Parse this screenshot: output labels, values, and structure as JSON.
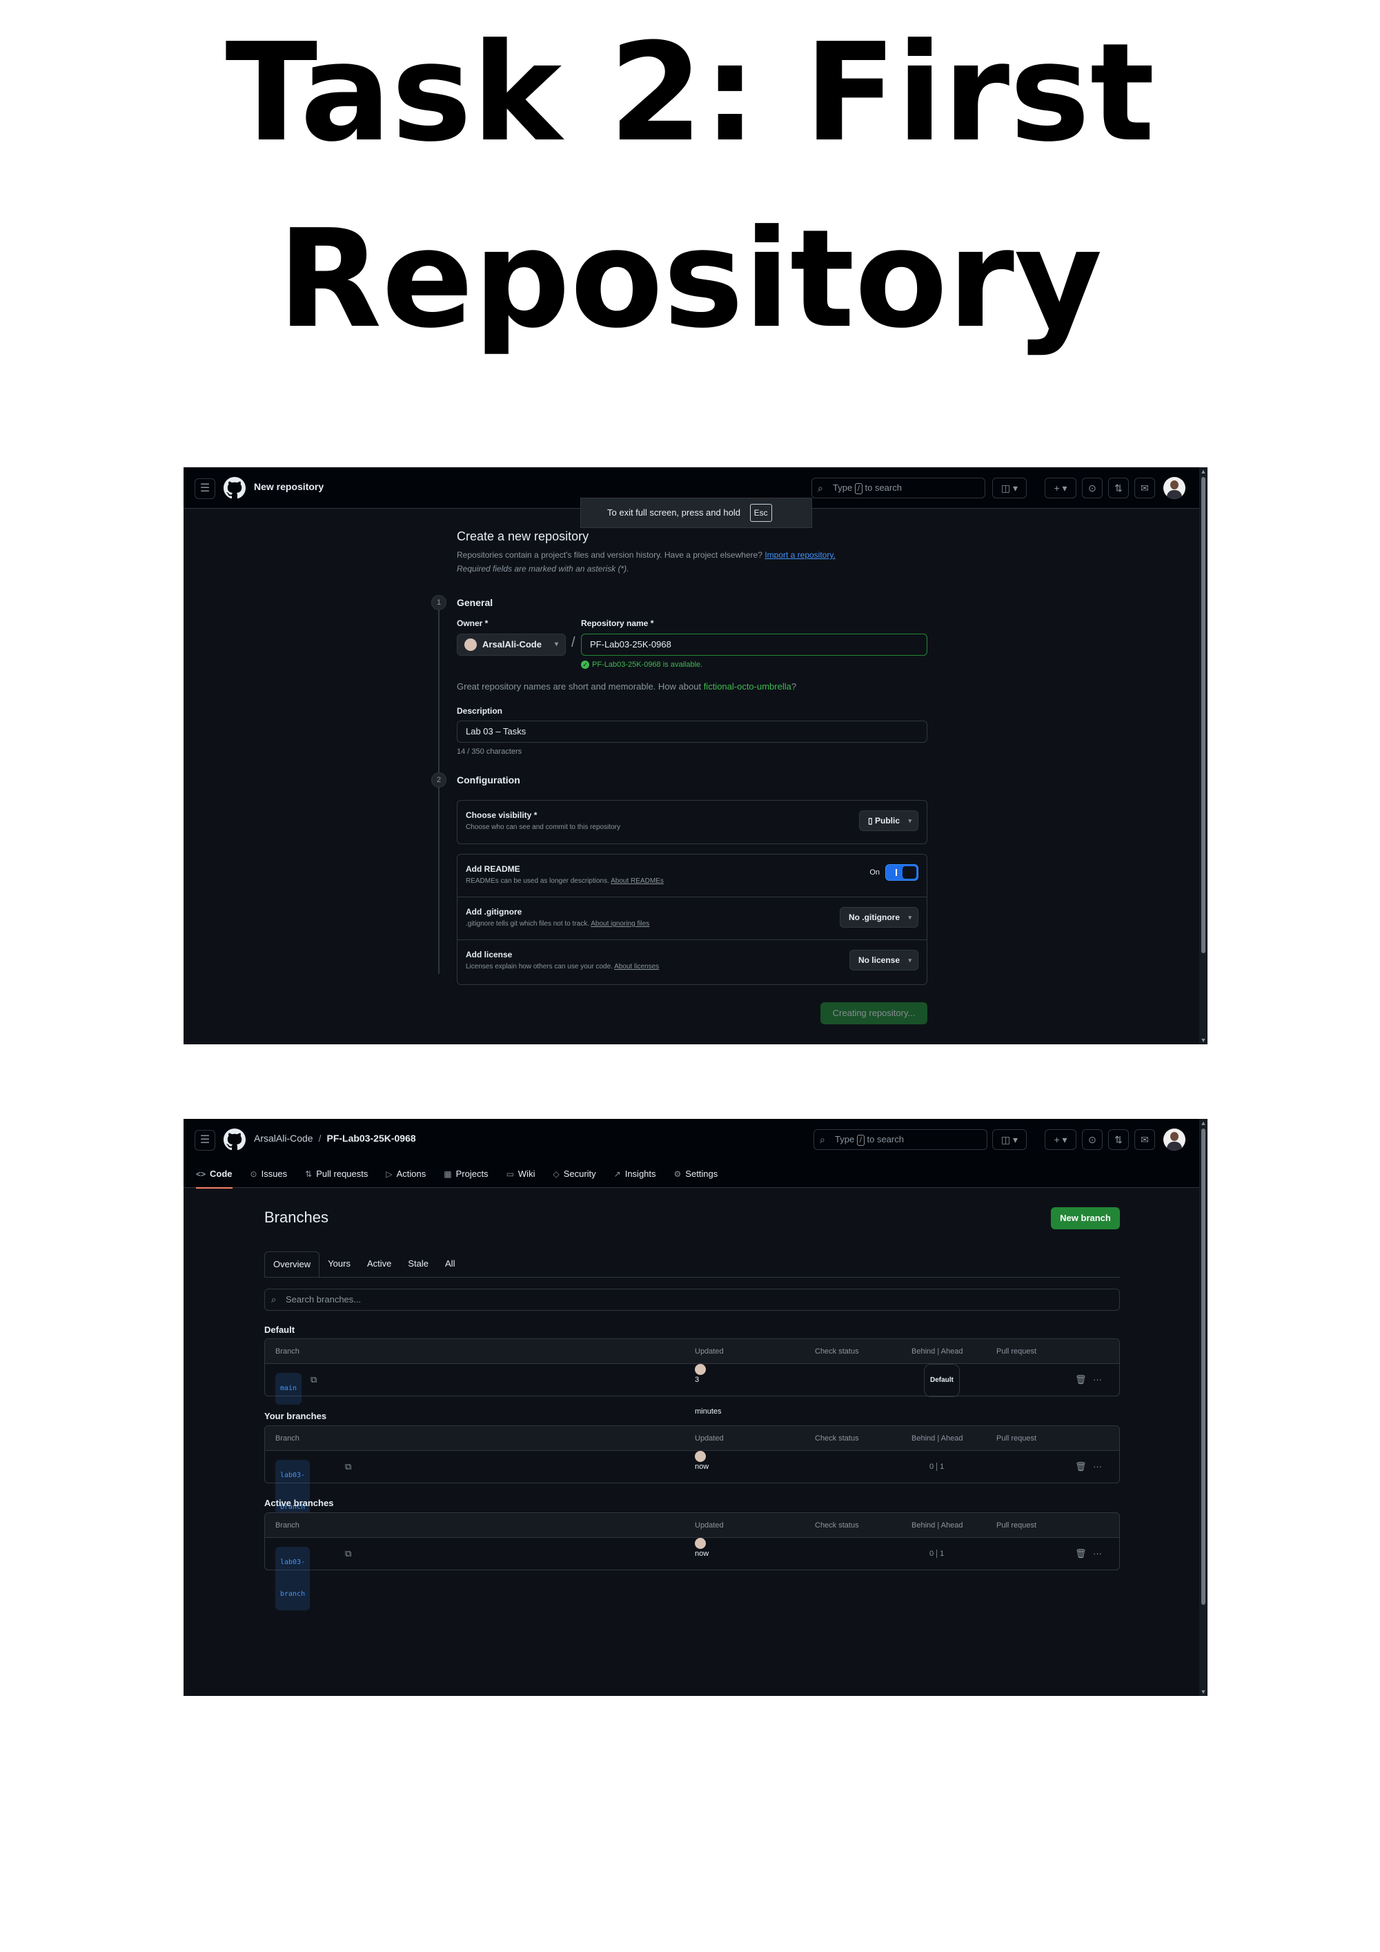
{
  "title": {
    "line1": "Task 2: First",
    "line2": "Repository"
  },
  "screenshot1": {
    "header": {
      "title": "New repository",
      "search_prefix": "Type",
      "search_key": "/",
      "search_suffix": "to search"
    },
    "fullscreen_tip": {
      "text": "To exit full screen, press and hold",
      "key": "Esc"
    },
    "form": {
      "heading": "Create a new repository",
      "subtitle": "Repositories contain a project's files and version history. Have a project elsewhere?",
      "import_link": "Import a repository.",
      "required_note": "Required fields are marked with an asterisk (*).",
      "step1_number": "1",
      "step1_title": "General",
      "owner_label": "Owner *",
      "owner_value": "ArsalAli-Code",
      "repo_name_label": "Repository name *",
      "repo_name_value": "PF-Lab03-25K-0968",
      "availability": "PF-Lab03-25K-0968 is available.",
      "name_hint": "Great repository names are short and memorable. How about",
      "name_suggestion": "fictional-octo-umbrella",
      "name_hint_end": "?",
      "description_label": "Description",
      "description_value": "Lab 03 – Tasks",
      "char_count": "14 / 350 characters",
      "step2_number": "2",
      "step2_title": "Configuration",
      "visibility_title": "Choose visibility *",
      "visibility_desc": "Choose who can see and commit to this repository",
      "visibility_value": "Public",
      "readme_title": "Add README",
      "readme_desc": "READMEs can be used as longer descriptions.",
      "readme_link": "About READMEs",
      "readme_state": "On",
      "gitignore_title": "Add .gitignore",
      "gitignore_desc": ".gitignore tells git which files not to track.",
      "gitignore_link": "About ignoring files",
      "gitignore_value": "No .gitignore",
      "license_title": "Add license",
      "license_desc": "Licenses explain how others can use your code.",
      "license_link": "About licenses",
      "license_value": "No license",
      "create_button": "Creating repository..."
    }
  },
  "screenshot2": {
    "header": {
      "owner": "ArsalAli-Code",
      "separator": "/",
      "repo": "PF-Lab03-25K-0968",
      "search_prefix": "Type",
      "search_key": "/",
      "search_suffix": "to search"
    },
    "nav": [
      "Code",
      "Issues",
      "Pull requests",
      "Actions",
      "Projects",
      "Wiki",
      "Security",
      "Insights",
      "Settings"
    ],
    "page_title": "Branches",
    "new_branch_button": "New branch",
    "subtabs": [
      "Overview",
      "Yours",
      "Active",
      "Stale",
      "All"
    ],
    "search_placeholder": "Search branches...",
    "columns": {
      "branch": "Branch",
      "updated": "Updated",
      "check_status": "Check status",
      "behind": "Behind",
      "ahead": "Ahead",
      "pull_request": "Pull request"
    },
    "groups": [
      {
        "title": "Default",
        "branch": "main",
        "updated": "3 minutes ago",
        "behind": "",
        "ahead": "",
        "badge": "Default"
      },
      {
        "title": "Your branches",
        "branch": "lab03-branch",
        "updated": "now",
        "behind": "0",
        "ahead": "1",
        "badge": ""
      },
      {
        "title": "Active branches",
        "branch": "lab03-branch",
        "updated": "now",
        "behind": "0",
        "ahead": "1",
        "badge": ""
      }
    ]
  }
}
